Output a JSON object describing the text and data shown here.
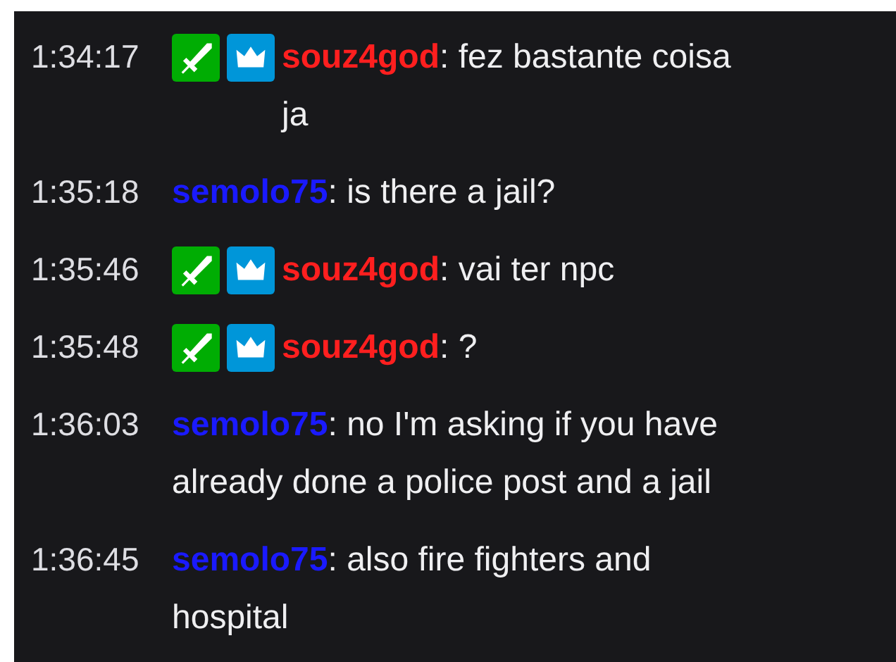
{
  "messages": [
    {
      "time": "1:34:17",
      "badges": [
        {
          "kind": "sword"
        },
        {
          "kind": "crown"
        }
      ],
      "user": "souz4god",
      "color": "#ff1f1f",
      "separator": ":",
      "text": "fez bastante coisa ja"
    },
    {
      "time": "1:35:18",
      "user": "semolo75",
      "color": "#1a1aff",
      "separator": ":",
      "text": "is there a jail?"
    },
    {
      "time": "1:35:46",
      "badges": [
        {
          "kind": "sword"
        },
        {
          "kind": "crown"
        }
      ],
      "user": "souz4god",
      "color": "#ff1f1f",
      "separator": ":",
      "text": "vai ter npc"
    },
    {
      "time": "1:35:48",
      "badges": [
        {
          "kind": "sword"
        },
        {
          "kind": "crown"
        }
      ],
      "user": "souz4god",
      "color": "#ff1f1f",
      "separator": ":",
      "text": "?"
    },
    {
      "time": "1:36:03",
      "user": "semolo75",
      "color": "#1a1aff",
      "separator": ":",
      "text": "no I'm asking if you have already done a police post and a jail"
    },
    {
      "time": "1:36:45",
      "user": "semolo75",
      "color": "#1a1aff",
      "separator": ":",
      "text": "also fire fighters and hospital"
    }
  ]
}
